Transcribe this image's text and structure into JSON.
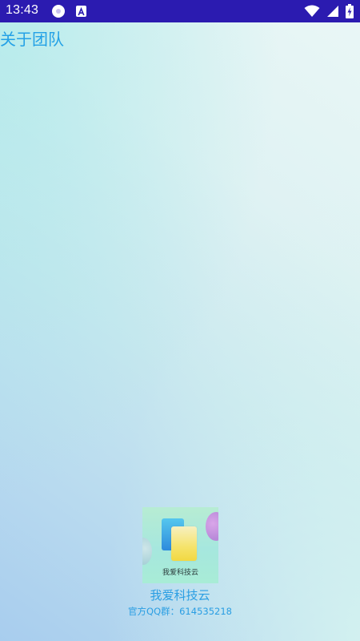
{
  "status_bar": {
    "time": "13:43",
    "background": "#2b1bb0",
    "icons": [
      "notification-circle-icon",
      "text-a-icon",
      "wifi-icon",
      "signal-icon",
      "battery-charging-icon"
    ]
  },
  "page": {
    "title": "关于团队",
    "title_color": "#24a1e6"
  },
  "logo": {
    "caption": "我爱科技云"
  },
  "footer": {
    "app_name": "我爱科技云",
    "qq_group": "官方QQ群：614535218",
    "text_color": "#2a9ee3"
  }
}
